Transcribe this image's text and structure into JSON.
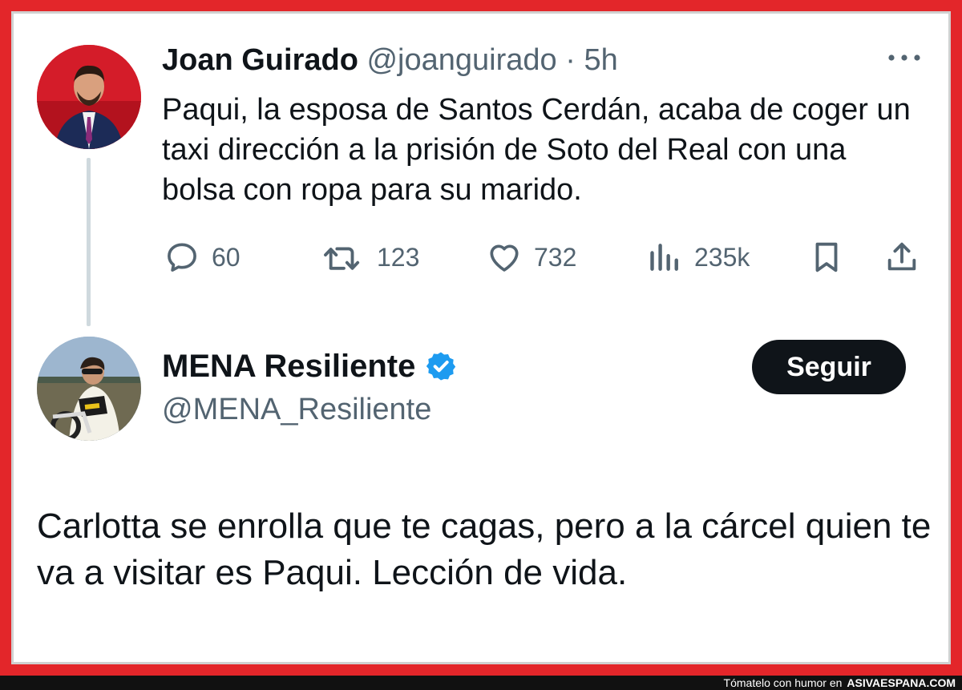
{
  "tweet1": {
    "author_name": "Joan Guirado",
    "handle": "@joanguirado",
    "separator": "·",
    "time": "5h",
    "text": "Paqui, la esposa de Santos Cerdán, acaba de coger un taxi dirección a la prisión de Soto del Real con una bolsa con ropa para su marido.",
    "actions": {
      "replies": "60",
      "retweets": "123",
      "likes": "732",
      "views": "235k"
    },
    "icons": [
      "more-icon",
      "reply-icon",
      "retweet-icon",
      "like-icon",
      "views-icon",
      "bookmark-icon",
      "share-icon"
    ]
  },
  "tweet2": {
    "author_name": "MENA Resiliente",
    "handle": "@MENA_Resiliente",
    "follow_label": "Seguir",
    "verified": true,
    "text": "Carlotta se enrolla que te cagas, pero a la cárcel quien te va a visitar es Paqui. Lección de vida."
  },
  "footer": {
    "caption": "Tómatelo con humor en",
    "site": "ASIVAESPANA.COM"
  },
  "colors": {
    "border": "#e3262a",
    "text": "#0f1419",
    "secondary": "#536471",
    "verified": "#1d9bf0",
    "button": "#0f1419"
  }
}
